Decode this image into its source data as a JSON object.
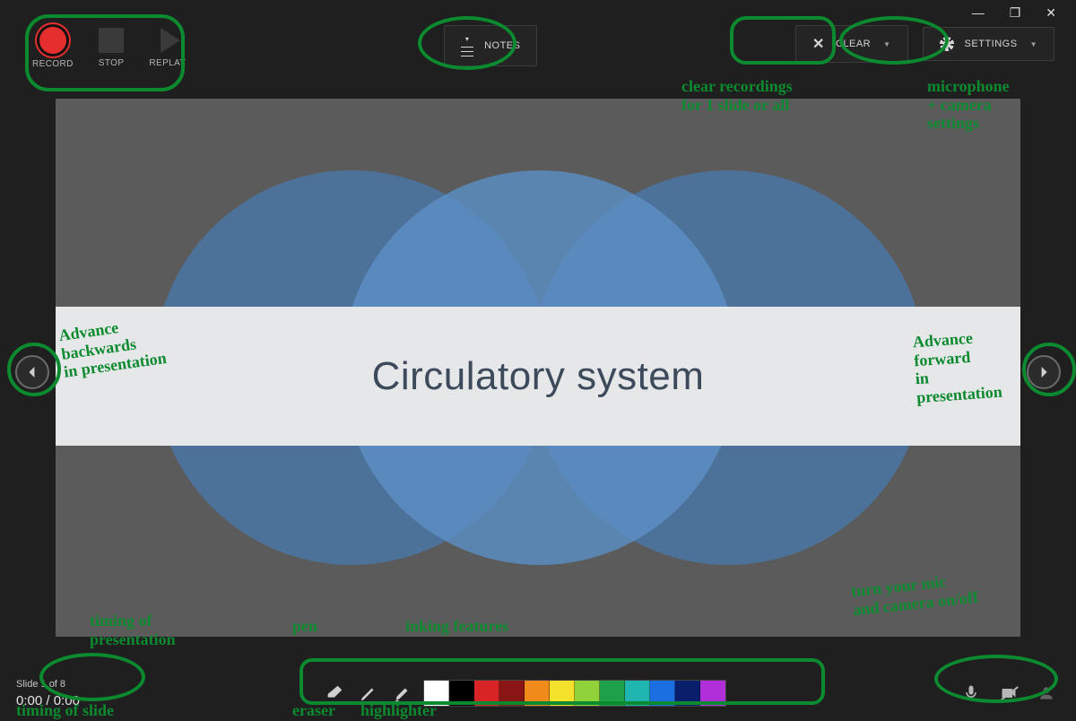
{
  "titlebar": {
    "minimize": "—",
    "maximize": "❐",
    "close": "✕"
  },
  "toolbar": {
    "record_label": "RECORD",
    "stop_label": "STOP",
    "replay_label": "REPLAY",
    "notes_label": "NOTES",
    "clear_label": "CLEAR",
    "settings_label": "SETTINGS"
  },
  "slide": {
    "title": "Circulatory system"
  },
  "status": {
    "slide_counter": "Slide 1 of 8",
    "elapsed": "0:00",
    "separator": " / ",
    "total": "0:00"
  },
  "ink": {
    "colors": [
      "#ffffff",
      "#000000",
      "#d82424",
      "#8a1515",
      "#f08a1b",
      "#f4e12a",
      "#8fd23a",
      "#1fa04a",
      "#1fb5b0",
      "#1b6fe0",
      "#0a1f6b",
      "#b02fd8"
    ]
  },
  "annotations": {
    "clear": "clear recordings\nfor 1 slide or all",
    "settings": "microphone\n+ camera\nsettings",
    "advance_back": "Advance\nbackwards\nin presentation",
    "advance_fwd": "Advance\nforward\nin\npresentation",
    "timing_pres": "timing of\npresentation",
    "timing_slide": "timing of slide",
    "pen": "pen",
    "ink": "inking features",
    "eraser": "eraser",
    "highlighter": "highlighter",
    "media": "turn your mic\nand camera on/off"
  }
}
